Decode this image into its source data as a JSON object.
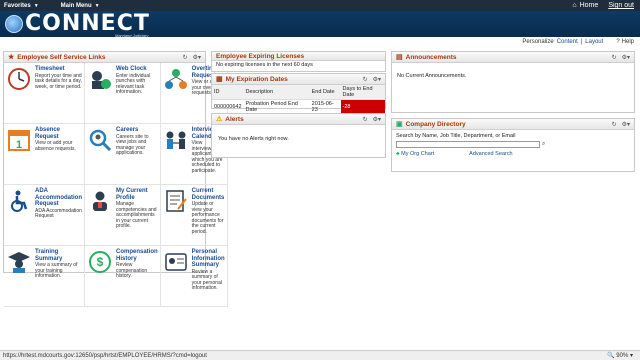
{
  "topbar": {
    "favorites": "Favorites",
    "main_menu": "Main Menu",
    "home": "Home",
    "signout": "Sign out"
  },
  "banner": {
    "logo_text": "CONNECT",
    "logo_sub": "Maryland Judiciary"
  },
  "personalize": {
    "label": "Personalize",
    "content": "Content",
    "sep": "|",
    "layout": "Layout",
    "help": "Help"
  },
  "ess": {
    "title": "Employee Self Service Links",
    "tiles": [
      {
        "title": "Timesheet",
        "desc": "Report your time and task details for a day, week, or time period."
      },
      {
        "title": "Web Clock",
        "desc": "Enter individual punches with relevant task information."
      },
      {
        "title": "Overtime Requests",
        "desc": "View or add your overtime requests."
      },
      {
        "title": "Absence Request",
        "desc": "View or add your absence requests."
      },
      {
        "title": "Careers",
        "desc": "Careers site to view jobs and manage your applications."
      },
      {
        "title": "Interview Calendar",
        "desc": "View interviews of applicants in which you are scheduled to participate."
      },
      {
        "title": "ADA Accommodation Request",
        "desc": "ADA Accommodation Request"
      },
      {
        "title": "My Current Profile",
        "desc": "Manage competencies and accomplishments in your current profile."
      },
      {
        "title": "Current Documents",
        "desc": "Update or view your performance documents for the current period."
      },
      {
        "title": "Training Summary",
        "desc": "View a summary of your training information."
      },
      {
        "title": "Compensation History",
        "desc": "Review compensation history."
      },
      {
        "title": "Personal Information Summary",
        "desc": "Review a summary of your personal information."
      }
    ]
  },
  "licenses": {
    "title": "Employee Expiring Licenses",
    "text": "No expiring licenses in the next 60 days"
  },
  "expiration": {
    "title": "My Expiration Dates",
    "columns": [
      "ID",
      "Description",
      "End Date",
      "Days to End Date"
    ],
    "rows": [
      [
        "000000642",
        "Probation Period End Date",
        "2015-06-23",
        "-28"
      ]
    ]
  },
  "alerts": {
    "title": "Alerts",
    "text": "You have no Alerts right now."
  },
  "announcements": {
    "title": "Announcements",
    "text": "No Current Announcements."
  },
  "directory": {
    "title": "Company Directory",
    "label": "Search by Name, Job Title, Department, or Email",
    "org_chart": "My Org Chart",
    "advanced": "Advanced Search"
  },
  "status": {
    "url": "https://hrtest.mdcourts.gov:12650/psp/hrtst/EMPLOYEE/HRMS/?cmd=logout",
    "zoom": "90%"
  }
}
